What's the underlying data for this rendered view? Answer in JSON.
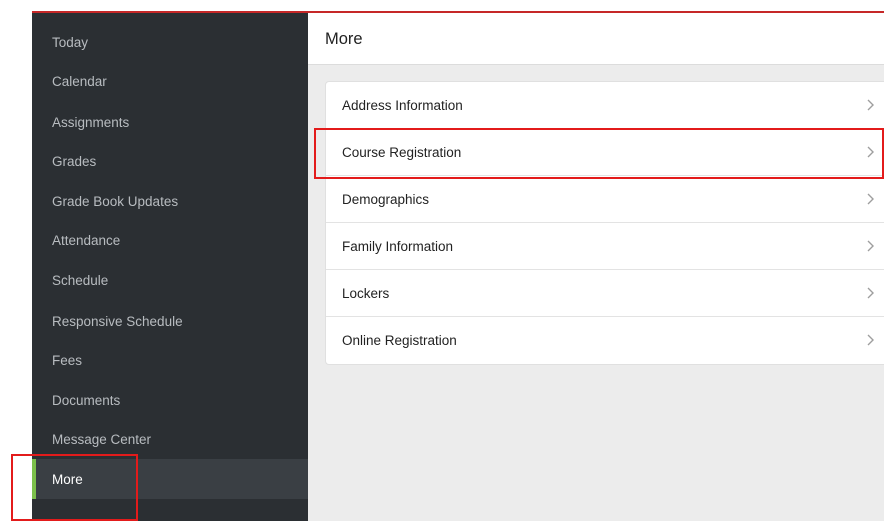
{
  "sidebar": {
    "items": [
      {
        "label": "Today"
      },
      {
        "label": "Calendar"
      },
      {
        "label": "Assignments"
      },
      {
        "label": "Grades"
      },
      {
        "label": "Grade Book Updates"
      },
      {
        "label": "Attendance"
      },
      {
        "label": "Schedule"
      },
      {
        "label": "Responsive Schedule"
      },
      {
        "label": "Fees"
      },
      {
        "label": "Documents"
      },
      {
        "label": "Message Center"
      },
      {
        "label": "More"
      }
    ],
    "active_label": "More",
    "colors": {
      "background": "#2b2f33",
      "active_background": "#3a3f44",
      "active_accent": "#7cc04b",
      "text": "#b8bcc0"
    }
  },
  "main": {
    "title": "More",
    "items": [
      {
        "label": "Address Information"
      },
      {
        "label": "Course Registration"
      },
      {
        "label": "Demographics"
      },
      {
        "label": "Family Information"
      },
      {
        "label": "Lockers"
      },
      {
        "label": "Online Registration"
      }
    ],
    "icons": {
      "row_arrow": "chevron-right-icon"
    }
  },
  "annotations": {
    "highlight_color": "#e31b1b",
    "highlighted": [
      "Course Registration",
      "More"
    ]
  }
}
